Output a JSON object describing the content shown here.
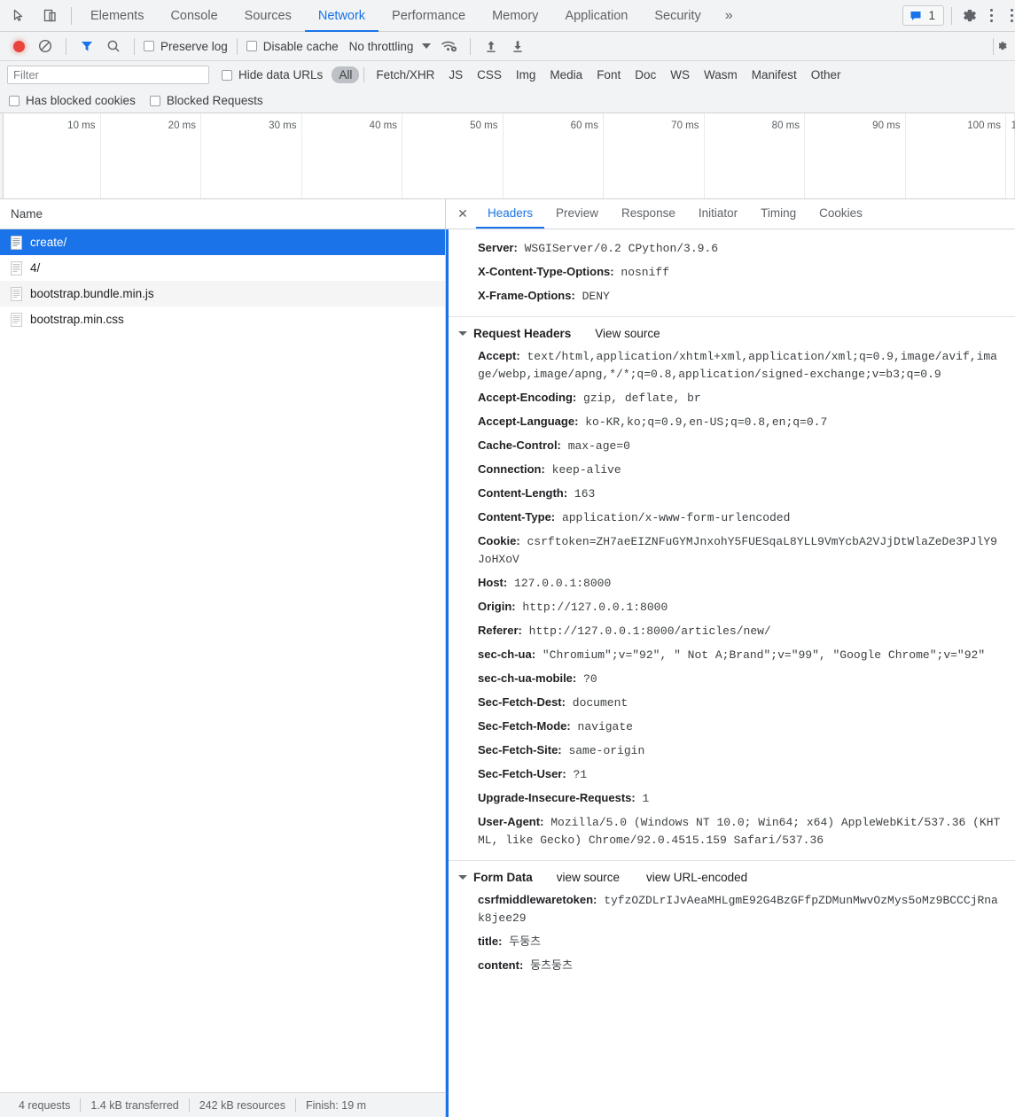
{
  "devtools": {
    "main_tabs": [
      {
        "label": "Elements",
        "active": false
      },
      {
        "label": "Console",
        "active": false
      },
      {
        "label": "Sources",
        "active": false
      },
      {
        "label": "Network",
        "active": true
      },
      {
        "label": "Performance",
        "active": false
      },
      {
        "label": "Memory",
        "active": false
      },
      {
        "label": "Application",
        "active": false
      },
      {
        "label": "Security",
        "active": false
      }
    ],
    "overflow_label": "»",
    "message_count": "1",
    "accent_color": "#1a73e8",
    "record_color": "#e8443c"
  },
  "network_toolbar": {
    "record_title": "record-button",
    "clear_title": "clear-button",
    "filter_title": "filter-toggle",
    "search_title": "search-button",
    "preserve_log": "Preserve log",
    "disable_cache": "Disable cache",
    "throttling": "No throttling",
    "import_title": "import-har",
    "export_title": "export-har"
  },
  "filter_bar": {
    "placeholder": "Filter",
    "value": "",
    "hide_data_urls": "Hide data URLs",
    "types": [
      {
        "label": "All",
        "active": true
      },
      {
        "label": "Fetch/XHR",
        "active": false
      },
      {
        "label": "JS",
        "active": false
      },
      {
        "label": "CSS",
        "active": false
      },
      {
        "label": "Img",
        "active": false
      },
      {
        "label": "Media",
        "active": false
      },
      {
        "label": "Font",
        "active": false
      },
      {
        "label": "Doc",
        "active": false
      },
      {
        "label": "WS",
        "active": false
      },
      {
        "label": "Wasm",
        "active": false
      },
      {
        "label": "Manifest",
        "active": false
      },
      {
        "label": "Other",
        "active": false
      }
    ],
    "has_blocked_cookies": "Has blocked cookies",
    "blocked_requests": "Blocked Requests"
  },
  "overview": {
    "ticks": [
      "10 ms",
      "20 ms",
      "30 ms",
      "40 ms",
      "50 ms",
      "60 ms",
      "70 ms",
      "80 ms",
      "90 ms",
      "100 ms",
      "1"
    ]
  },
  "request_list": {
    "column_header": "Name",
    "rows": [
      {
        "name": "create/",
        "selected": true
      },
      {
        "name": "4/",
        "selected": false
      },
      {
        "name": "bootstrap.bundle.min.js",
        "selected": false
      },
      {
        "name": "bootstrap.min.css",
        "selected": false
      }
    ]
  },
  "status_bar": {
    "requests": "4 requests",
    "transferred": "1.4 kB transferred",
    "resources": "242 kB resources",
    "finish": "Finish: 19 m"
  },
  "detail_panel": {
    "close_label": "✕",
    "tabs": [
      {
        "label": "Headers",
        "active": true
      },
      {
        "label": "Preview",
        "active": false
      },
      {
        "label": "Response",
        "active": false
      },
      {
        "label": "Initiator",
        "active": false
      },
      {
        "label": "Timing",
        "active": false
      },
      {
        "label": "Cookies",
        "active": false
      }
    ],
    "response_headers_visible": [
      {
        "key": "Server:",
        "value": "WSGIServer/0.2 CPython/3.9.6"
      },
      {
        "key": "X-Content-Type-Options:",
        "value": "nosniff"
      },
      {
        "key": "X-Frame-Options:",
        "value": "DENY"
      }
    ],
    "request_headers_section": {
      "title": "Request Headers",
      "view_source": "View source",
      "headers": [
        {
          "key": "Accept:",
          "value": "text/html,application/xhtml+xml,application/xml;q=0.9,image/avif,image/webp,image/apng,*/*;q=0.8,application/signed-exchange;v=b3;q=0.9"
        },
        {
          "key": "Accept-Encoding:",
          "value": "gzip, deflate, br"
        },
        {
          "key": "Accept-Language:",
          "value": "ko-KR,ko;q=0.9,en-US;q=0.8,en;q=0.7"
        },
        {
          "key": "Cache-Control:",
          "value": "max-age=0"
        },
        {
          "key": "Connection:",
          "value": "keep-alive"
        },
        {
          "key": "Content-Length:",
          "value": "163"
        },
        {
          "key": "Content-Type:",
          "value": "application/x-www-form-urlencoded"
        },
        {
          "key": "Cookie:",
          "value": "csrftoken=ZH7aeEIZNFuGYMJnxohY5FUESqaL8YLL9VmYcbA2VJjDtWlaZeDe3PJlY9JoHXoV"
        },
        {
          "key": "Host:",
          "value": "127.0.0.1:8000"
        },
        {
          "key": "Origin:",
          "value": "http://127.0.0.1:8000"
        },
        {
          "key": "Referer:",
          "value": "http://127.0.0.1:8000/articles/new/"
        },
        {
          "key": "sec-ch-ua:",
          "value": "\"Chromium\";v=\"92\", \" Not A;Brand\";v=\"99\", \"Google Chrome\";v=\"92\""
        },
        {
          "key": "sec-ch-ua-mobile:",
          "value": "?0"
        },
        {
          "key": "Sec-Fetch-Dest:",
          "value": "document"
        },
        {
          "key": "Sec-Fetch-Mode:",
          "value": "navigate"
        },
        {
          "key": "Sec-Fetch-Site:",
          "value": "same-origin"
        },
        {
          "key": "Sec-Fetch-User:",
          "value": "?1"
        },
        {
          "key": "Upgrade-Insecure-Requests:",
          "value": "1"
        },
        {
          "key": "User-Agent:",
          "value": "Mozilla/5.0 (Windows NT 10.0; Win64; x64) AppleWebKit/537.36 (KHTML, like Gecko) Chrome/92.0.4515.159 Safari/537.36"
        }
      ]
    },
    "form_data_section": {
      "title": "Form Data",
      "view_source": "view source",
      "view_url_encoded": "view URL-encoded",
      "fields": [
        {
          "key": "csrfmiddlewaretoken:",
          "value": "tyfzOZDLrIJvAeaMHLgmE92G4BzGFfpZDMunMwvOzMys5oMz9BCCCjRnak8jee29"
        },
        {
          "key": "title:",
          "value": "두둥츠"
        },
        {
          "key": "content:",
          "value": "둥츠둥츠"
        }
      ]
    }
  }
}
